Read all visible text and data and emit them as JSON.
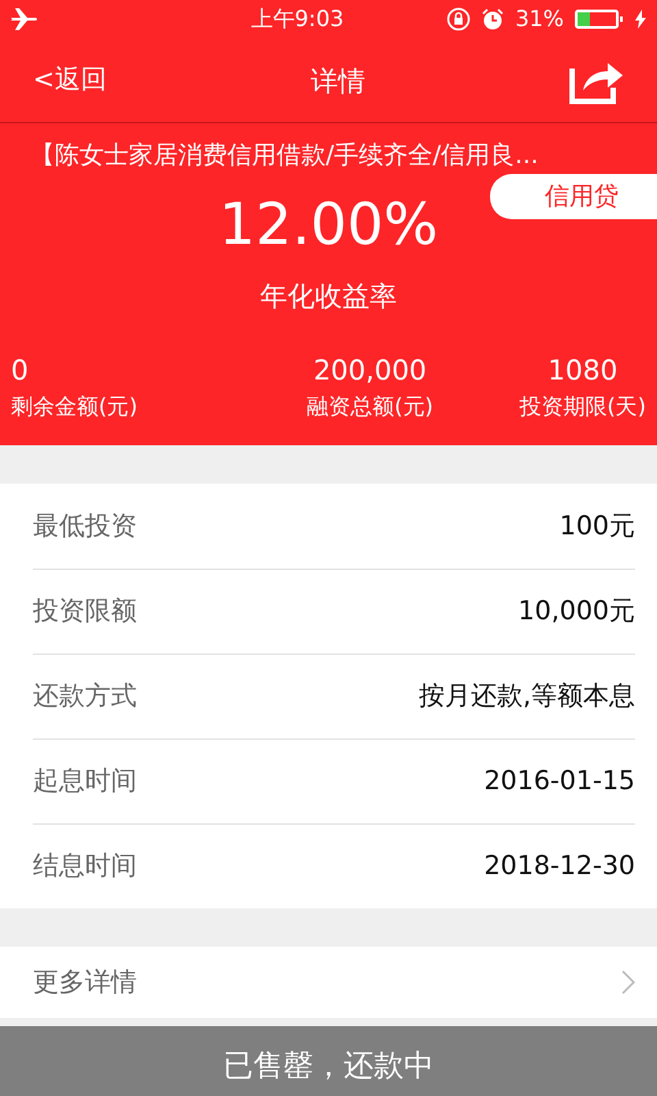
{
  "status_bar": {
    "time": "上午9:03",
    "battery_text": "31%"
  },
  "navbar": {
    "back": "<返回",
    "title": "详情"
  },
  "product": {
    "title": "【陈女士家居消费信用借款/手续齐全/信用良...",
    "tag": "信用贷",
    "rate": "12.00%",
    "rate_label": "年化收益率",
    "stats": [
      {
        "value": "0",
        "label": "剩余金额(元)"
      },
      {
        "value": "200,000",
        "label": "融资总额(元)"
      },
      {
        "value": "1080",
        "label": "投资期限(天)"
      }
    ]
  },
  "details": [
    {
      "label": "最低投资",
      "value": "100元"
    },
    {
      "label": "投资限额",
      "value": "10,000元"
    },
    {
      "label": "还款方式",
      "value": "按月还款,等额本息"
    },
    {
      "label": "起息时间",
      "value": "2016-01-15"
    },
    {
      "label": "结息时间",
      "value": "2018-12-30"
    }
  ],
  "more": {
    "label": "更多详情"
  },
  "bottom_button": {
    "label": "已售罄，还款中",
    "disabled": true
  }
}
